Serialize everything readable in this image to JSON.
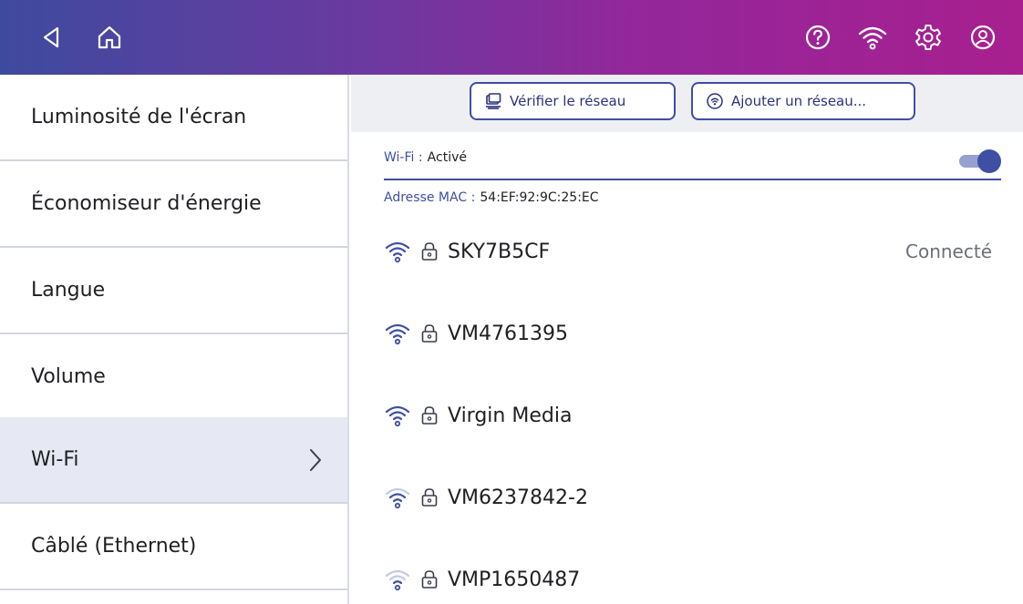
{
  "colors": {
    "accent": "#3f4fa3",
    "header_gradient_start": "#3e4a9e",
    "header_gradient_end": "#a81f8f",
    "selected_row_bg": "#e6e9f4",
    "button_bar_bg": "#eeeff3"
  },
  "header": {
    "icons": [
      "back-icon",
      "home-icon",
      "help-icon",
      "wifi-icon",
      "settings-icon",
      "account-icon"
    ]
  },
  "sidebar": {
    "items": [
      {
        "label": "Luminosité de l'écran",
        "selected": false
      },
      {
        "label": "Économiseur d'énergie",
        "selected": false
      },
      {
        "label": "Langue",
        "selected": false
      },
      {
        "label": "Volume",
        "selected": false
      },
      {
        "label": "Wi-Fi",
        "selected": true
      },
      {
        "label": "Câblé (Ethernet)",
        "selected": false
      }
    ]
  },
  "toolbar": {
    "check_network_label": "Vérifier le réseau",
    "add_network_label": "Ajouter un réseau..."
  },
  "wifi": {
    "label": "Wi-Fi :",
    "value": "Activé",
    "enabled": true
  },
  "mac": {
    "label": "Adresse MAC :",
    "value": "54:EF:92:9C:25:EC"
  },
  "networks": [
    {
      "ssid": "SKY7B5CF",
      "status": "Connecté",
      "signal": 1.0,
      "secured": true
    },
    {
      "ssid": "VM4761395",
      "status": "",
      "signal": 1.0,
      "secured": true
    },
    {
      "ssid": "Virgin Media",
      "status": "",
      "signal": 1.0,
      "secured": true
    },
    {
      "ssid": "VM6237842-2",
      "status": "",
      "signal": 0.5,
      "secured": true
    },
    {
      "ssid": "VMP1650487",
      "status": "",
      "signal": 0.25,
      "secured": true
    }
  ]
}
